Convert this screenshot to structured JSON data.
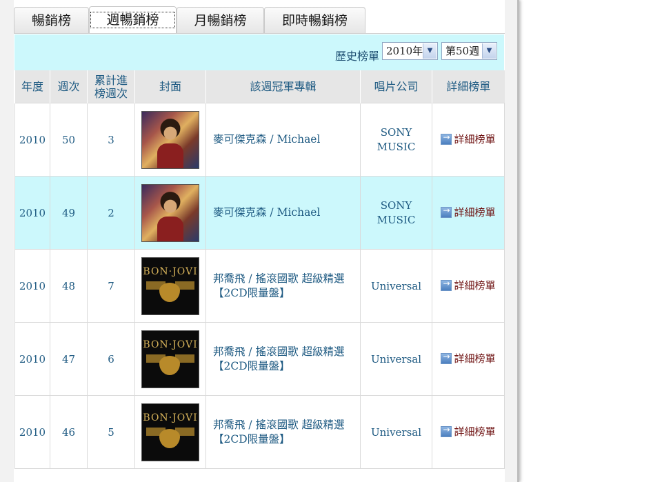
{
  "tabs": [
    {
      "label": "暢銷榜",
      "active": false
    },
    {
      "label": "週暢銷榜",
      "active": true
    },
    {
      "label": "月暢銷榜",
      "active": false
    },
    {
      "label": "即時暢銷榜",
      "active": false
    }
  ],
  "filter": {
    "label": "歷史榜單",
    "year_selected": "2010年",
    "week_selected": "第50週"
  },
  "table": {
    "headers": {
      "year": "年度",
      "week": "週次",
      "cumulative": "累計進榜週次",
      "cover": "封面",
      "album": "該週冠軍專輯",
      "label": "唱片公司",
      "detail": "詳細榜單"
    },
    "rows": [
      {
        "year": "2010",
        "week": "50",
        "cumulative": "3",
        "cover": "michael-cover",
        "album": "麥可傑克森 / Michael",
        "label": "SONY MUSIC",
        "detail": "詳細榜單"
      },
      {
        "year": "2010",
        "week": "49",
        "cumulative": "2",
        "cover": "michael-cover",
        "album": "麥可傑克森 / Michael",
        "label": "SONY MUSIC",
        "detail": "詳細榜單"
      },
      {
        "year": "2010",
        "week": "48",
        "cumulative": "7",
        "cover": "bonjovi-cover",
        "album": "邦喬飛 / 搖滾國歌 超級精選【2CD限量盤】",
        "label": "Universal",
        "detail": "詳細榜單"
      },
      {
        "year": "2010",
        "week": "47",
        "cumulative": "6",
        "cover": "bonjovi-cover",
        "album": "邦喬飛 / 搖滾國歌 超級精選【2CD限量盤】",
        "label": "Universal",
        "detail": "詳細榜單"
      },
      {
        "year": "2010",
        "week": "46",
        "cumulative": "5",
        "cover": "bonjovi-cover",
        "album": "邦喬飛 / 搖滾國歌 超級精選【2CD限量盤】",
        "label": "Universal",
        "detail": "詳細榜單"
      }
    ],
    "cover_text_bonjovi": "BON·JOVI"
  },
  "colors": {
    "link": "#1e5a82",
    "detail_link": "#6d1010",
    "highlight_row": "#ccf8fc",
    "header_bg": "#e6e6e6"
  }
}
